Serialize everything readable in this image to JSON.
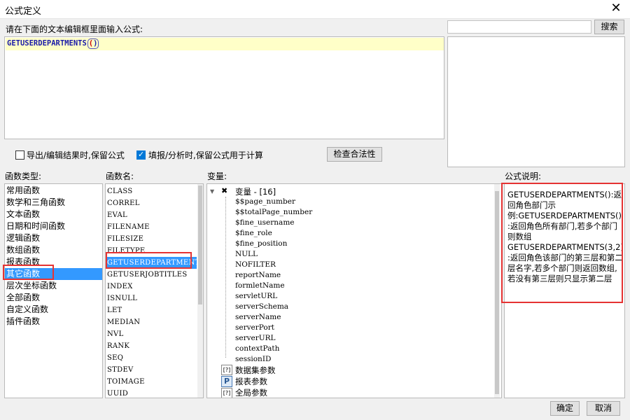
{
  "window": {
    "title": "公式定义",
    "close_glyph": "✕"
  },
  "editor": {
    "prompt": "请在下面的文本编辑框里面输入公式:",
    "formula_name": "GETUSERDEPARTMENTS",
    "formula_open": "(",
    "formula_close": ")"
  },
  "search": {
    "value": "",
    "button_label": "搜索"
  },
  "options": {
    "export_keep_label": "导出/编辑结果时,保留公式",
    "export_keep_checked": false,
    "fill_keep_label": "填报/分析时,保留公式用于计算",
    "fill_keep_checked": true,
    "validate_label": "检查合法性"
  },
  "func_types": {
    "header": "函数类型:",
    "items": [
      "常用函数",
      "数学和三角函数",
      "文本函数",
      "日期和时间函数",
      "逻辑函数",
      "数组函数",
      "报表函数",
      "其它函数",
      "层次坐标函数",
      "全部函数",
      "自定义函数",
      "插件函数"
    ],
    "selected_index": 7
  },
  "func_names": {
    "header": "函数名:",
    "items": [
      "CLASS",
      "CORREL",
      "EVAL",
      "FILENAME",
      "FILESIZE",
      "FILETYPE",
      "GETUSERDEPARTMENTS",
      "GETUSERJOBTITLES",
      "INDEX",
      "ISNULL",
      "LET",
      "MEDIAN",
      "NVL",
      "RANK",
      "SEQ",
      "STDEV",
      "TOIMAGE",
      "UUID"
    ],
    "selected_index": 6
  },
  "variables": {
    "header": "变量:",
    "root_label": "变量 - [16]",
    "items": [
      "$$page_number",
      "$$totalPage_number",
      "$fine_username",
      "$fine_role",
      "$fine_position",
      "NULL",
      "NOFILTER",
      "reportName",
      "formletName",
      "servletURL",
      "serverSchema",
      "serverName",
      "serverPort",
      "serverURL",
      "contextPath",
      "sessionID"
    ],
    "groups": [
      "数据集参数",
      "报表参数",
      "全局参数"
    ]
  },
  "description": {
    "header": "公式说明:",
    "text": "GETUSERDEPARTMENTS():返回角色部门示例:GETUSERDEPARTMENTS():返回角色所有部门,若多个部门则数组GETUSERDEPARTMENTS(3,2):返回角色该部门的第三层和第二层名字,若多个部门则返回数组,若没有第三层则只显示第二层"
  },
  "footer": {
    "ok_label": "确定",
    "cancel_label": "取消"
  },
  "colors": {
    "selection": "#3399ff",
    "highlight_box": "#e53333",
    "editor_line": "#ffffc8",
    "formula_text": "#1a1aa8"
  }
}
